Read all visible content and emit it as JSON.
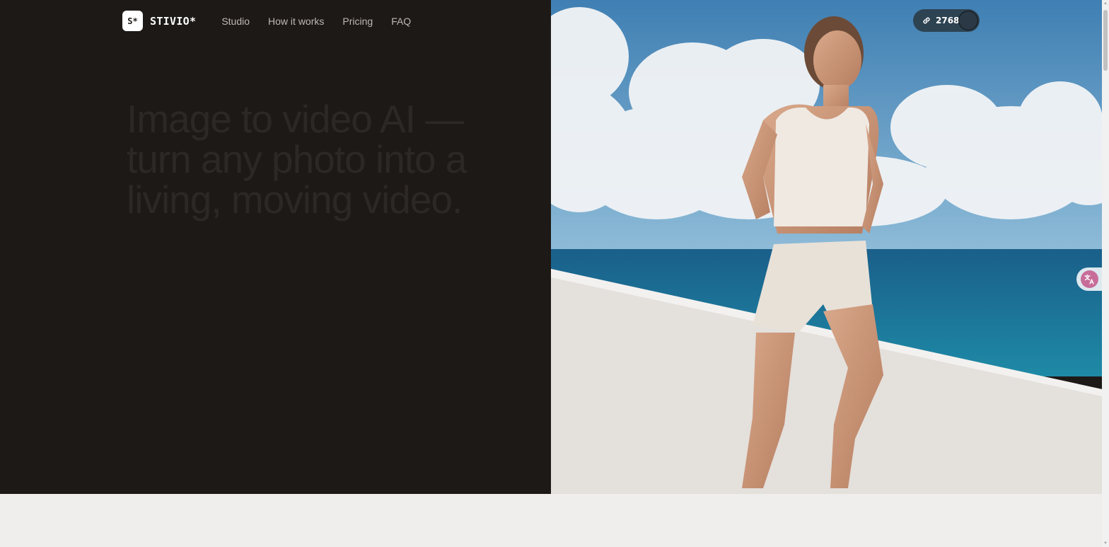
{
  "brand": {
    "logo_badge": "S*",
    "name": "STIVIO*"
  },
  "nav": {
    "links": [
      "Studio",
      "How it works",
      "Pricing",
      "FAQ"
    ]
  },
  "hero": {
    "headline": "Image to video AI — turn any photo into a living, moving video."
  },
  "credits": {
    "icon": "link-icon",
    "count": "2768"
  },
  "colors": {
    "hero_background": "#1d1917",
    "page_background": "#efeeec",
    "headline_text": "#2c2825",
    "nav_text": "#bdb8b3"
  }
}
